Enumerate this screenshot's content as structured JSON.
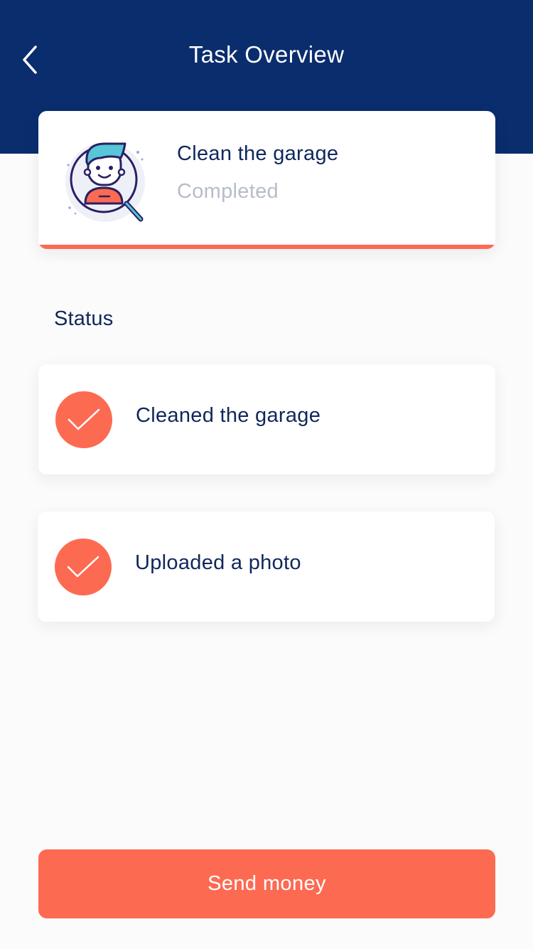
{
  "header": {
    "title": "Task Overview",
    "back_icon": "chevron-left-icon",
    "background_color": "#0a2d6e"
  },
  "task": {
    "title": "Clean the garage",
    "status": "Completed",
    "illustration": "person-magnifier-illustration",
    "accent_color": "#fd6a52"
  },
  "status_section": {
    "label": "Status",
    "items": [
      {
        "label": "Cleaned the garage",
        "icon": "check-icon",
        "done": true
      },
      {
        "label": "Uploaded a photo",
        "icon": "check-icon",
        "done": true
      }
    ]
  },
  "actions": {
    "send_label": "Send money",
    "button_color": "#fd6a52"
  }
}
